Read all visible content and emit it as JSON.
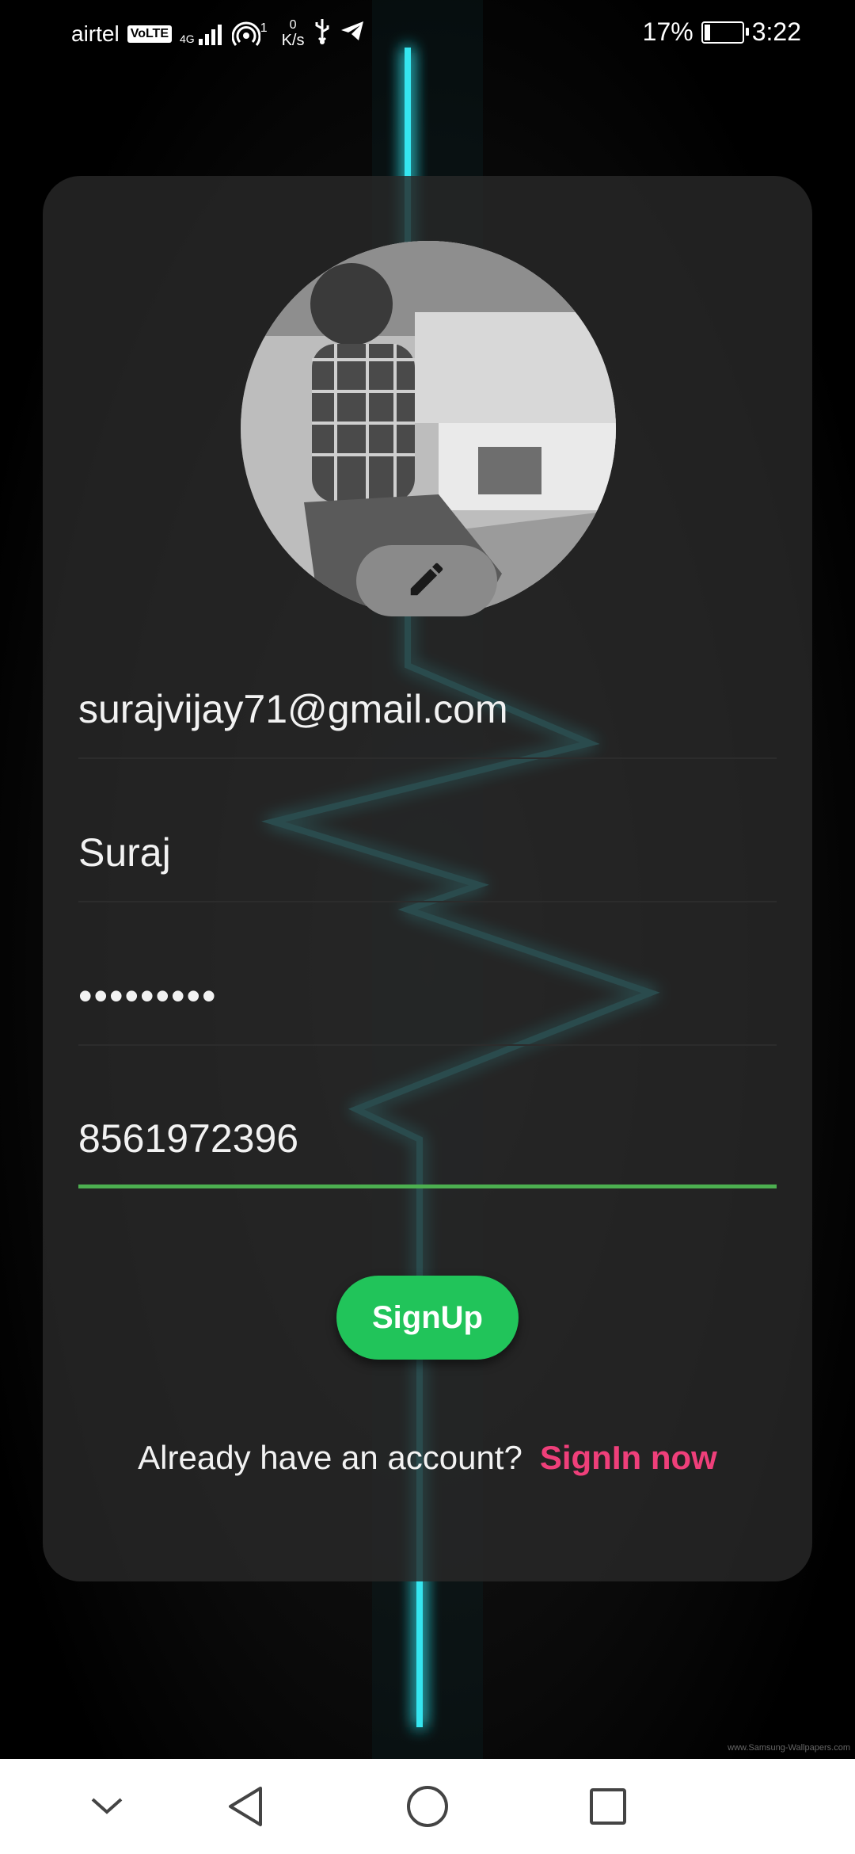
{
  "status_bar": {
    "carrier": "airtel",
    "volte": "VoLTE",
    "network": "4G",
    "hotspot_count": "1",
    "speed_value": "0",
    "speed_unit": "K/s",
    "battery_percent": "17%",
    "battery_level": 0.17,
    "time": "3:22"
  },
  "form": {
    "email": "surajvijay71@gmail.com",
    "name": "Suraj",
    "password_masked": "•••••••••",
    "phone": "8561972396",
    "signup_label": "SignUp",
    "signin_prompt": "Already have an account?",
    "signin_link": "SignIn now"
  },
  "colors": {
    "accent_green": "#21c45a",
    "active_underline": "#4caf50",
    "link_pink": "#ef3f7a",
    "neon_cyan": "#35e6f0"
  },
  "watermark": "www.Samsung-Wallpapers.com",
  "icons": {
    "edit": "pencil-icon",
    "nav": [
      "chevron-down-icon",
      "back-triangle-icon",
      "home-circle-icon",
      "recents-square-icon"
    ]
  }
}
